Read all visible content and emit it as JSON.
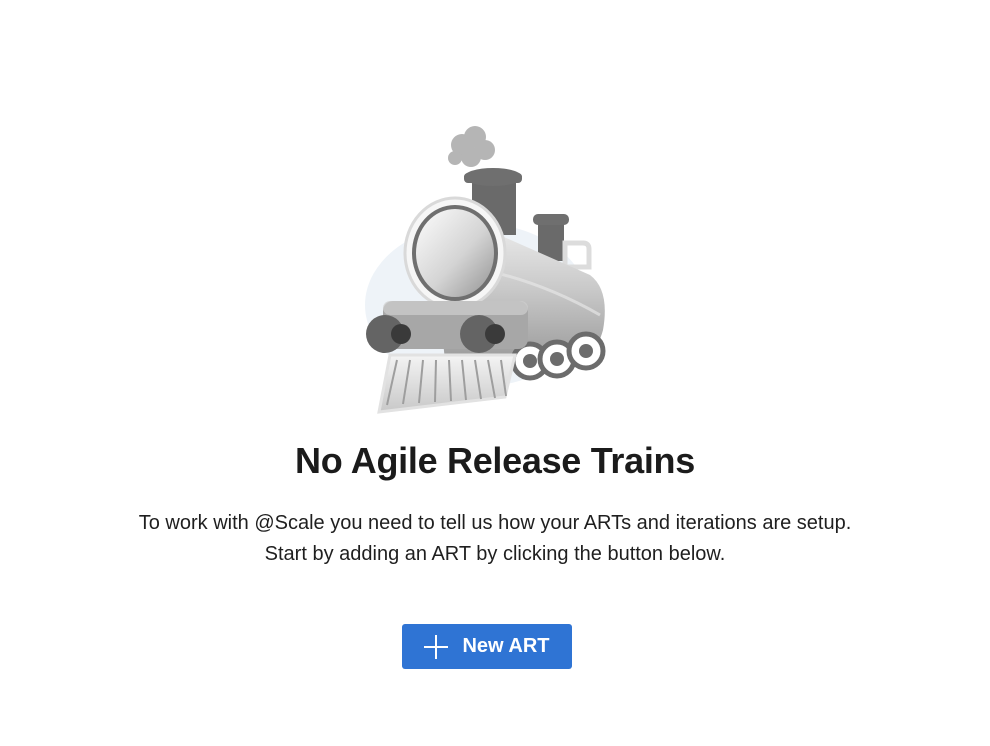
{
  "empty_state": {
    "illustration": "train-icon",
    "title": "No Agile Release Trains",
    "description_line1": "To work with @Scale you need to tell us how your ARTs and iterations are setup.",
    "description_line2": "Start by adding an ART by clicking the button below.",
    "button": {
      "label": "New ART",
      "icon": "plus-icon",
      "color": "#2f74d4"
    }
  }
}
